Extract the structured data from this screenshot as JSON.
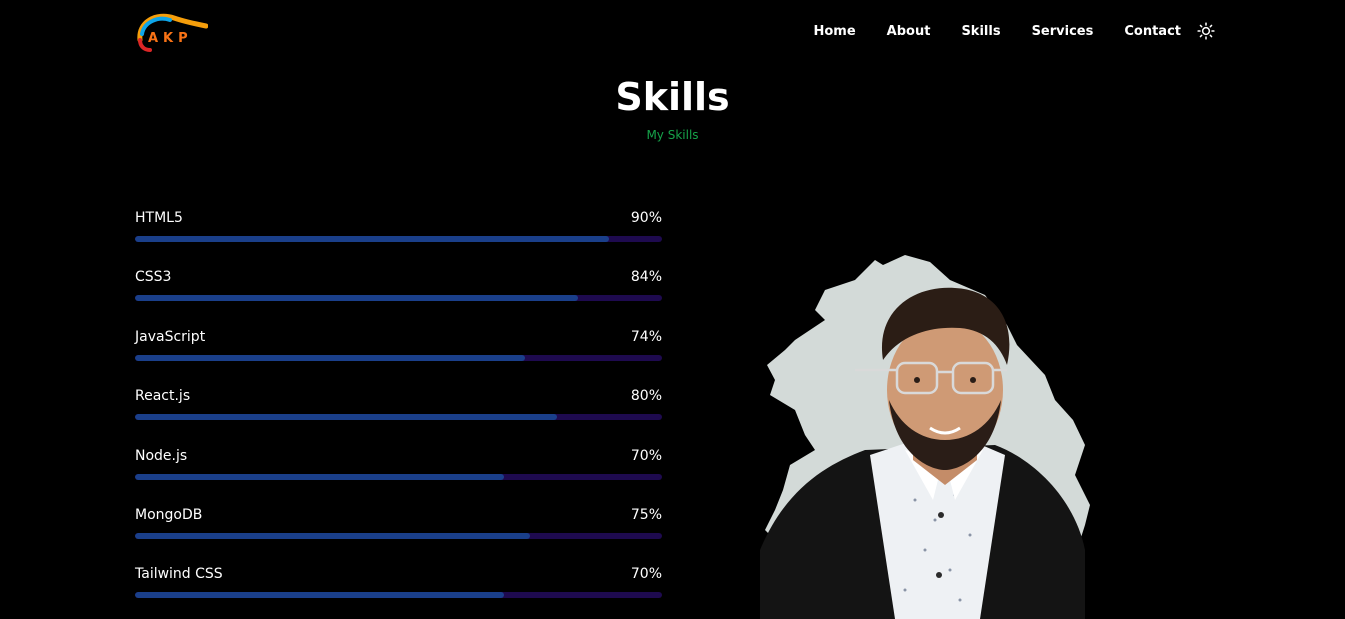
{
  "logo": {
    "text": "AKP"
  },
  "nav": {
    "items": [
      "Home",
      "About",
      "Skills",
      "Services",
      "Contact"
    ],
    "theme_toggle_icon": "sun-icon"
  },
  "section": {
    "title": "Skills",
    "subtitle": "My Skills"
  },
  "skills": [
    {
      "name": "HTML5",
      "percent_label": "90%",
      "level": 0.9
    },
    {
      "name": "CSS3",
      "percent_label": "84%",
      "level": 0.84
    },
    {
      "name": "JavaScript",
      "percent_label": "74%",
      "level": 0.74
    },
    {
      "name": "React.js",
      "percent_label": "80%",
      "level": 0.8
    },
    {
      "name": "Node.js",
      "percent_label": "70%",
      "level": 0.7
    },
    {
      "name": "MongoDB",
      "percent_label": "75%",
      "level": 0.75
    },
    {
      "name": "Tailwind CSS",
      "percent_label": "70%",
      "level": 0.7
    }
  ],
  "colors": {
    "background": "#000000",
    "accent_green": "#16a34a",
    "bar_fill": "#1a3f8a",
    "bar_track": "#1e0a4f",
    "logo_orange": "#f97316"
  }
}
